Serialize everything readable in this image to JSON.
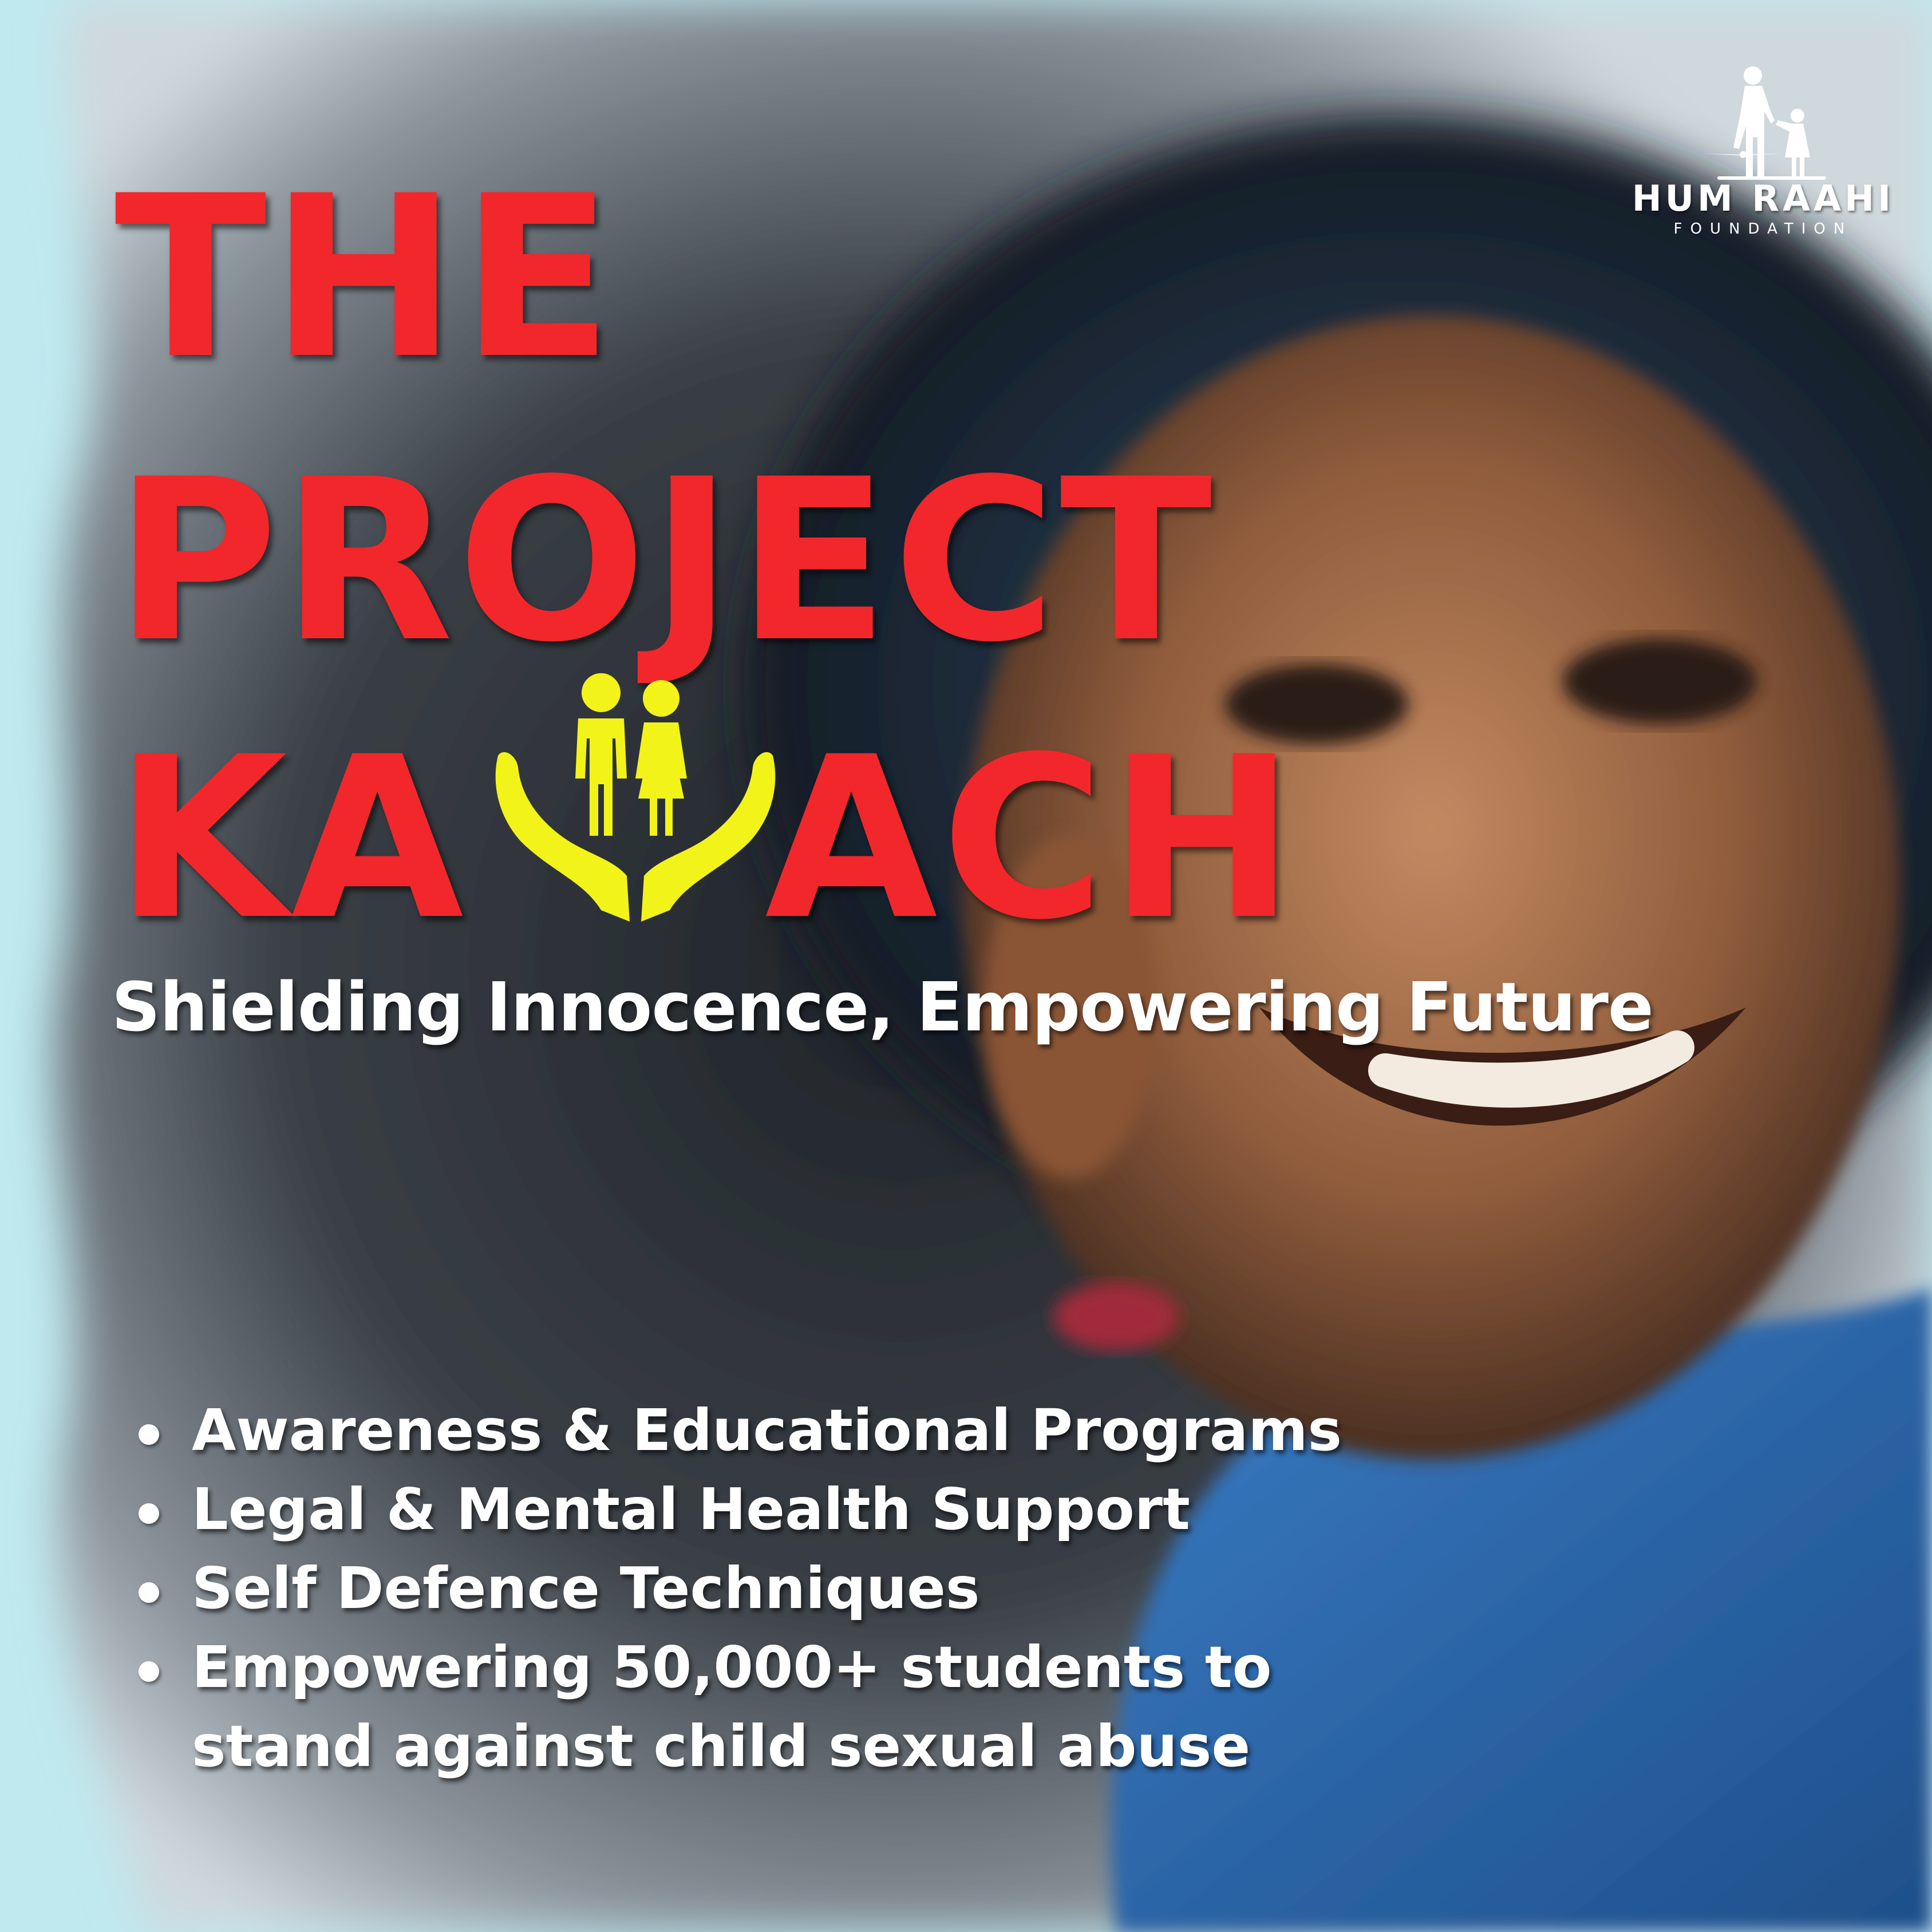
{
  "poster": {
    "title_line1": "THE",
    "title_line2": "PROJECT",
    "title_line3_start": "KA",
    "title_line3_end": "ACH",
    "tagline": "Shielding Innocence, Empowering Future",
    "emblem_icon": "children-in-hands-icon",
    "features": [
      "Awareness & Educational Programs",
      "Legal & Mental Health Support",
      "Self Defence Techniques",
      "Empowering 50,000+ students to",
      "stand against child sexual abuse"
    ]
  },
  "logo": {
    "name": "HUM RAAHI",
    "subtitle": "FOUNDATION",
    "icon": "adult-with-child-icon"
  },
  "colors": {
    "title_red": "#f1272c",
    "emblem_yellow": "#f2f318",
    "background_cyan": "#bfe9ef",
    "text_white": "#ffffff"
  }
}
